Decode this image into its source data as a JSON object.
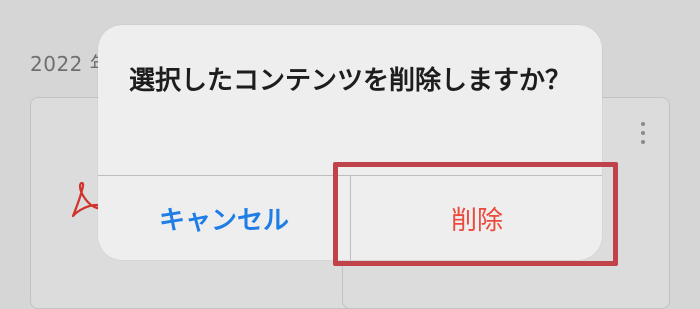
{
  "background": {
    "date_fragment": "2022 年",
    "pdf_icon": "pdf-icon",
    "more_icon": "more-vertical-icon"
  },
  "dialog": {
    "message": "選択したコンテンツを削除しますか？",
    "cancel_label": "キャンセル",
    "delete_label": "削除"
  },
  "colors": {
    "cancel": "#1f7de6",
    "delete": "#ea4b3c",
    "highlight": "#c0424a"
  }
}
